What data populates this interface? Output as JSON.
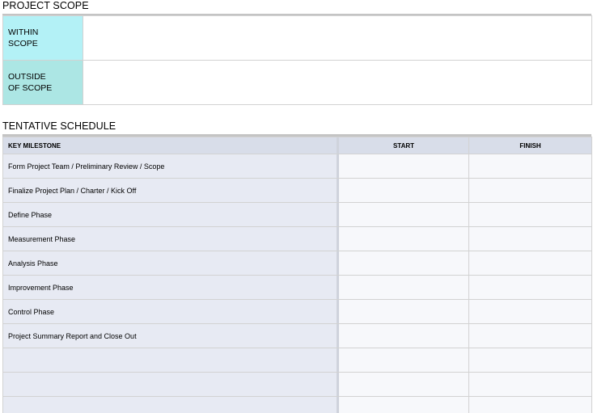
{
  "project_scope": {
    "title": "PROJECT SCOPE",
    "rows": [
      {
        "label": "WITHIN\nSCOPE",
        "value": ""
      },
      {
        "label": "OUTSIDE\nOF SCOPE",
        "value": ""
      }
    ],
    "colors": {
      "within": "#b3f1f6",
      "outside": "#ace6e4"
    }
  },
  "schedule": {
    "title": "TENTATIVE SCHEDULE",
    "headers": {
      "milestone": "KEY MILESTONE",
      "start": "START",
      "finish": "FINISH"
    },
    "rows": [
      {
        "milestone": "Form Project Team / Preliminary Review / Scope",
        "start": "",
        "finish": ""
      },
      {
        "milestone": "Finalize Project Plan / Charter / Kick Off",
        "start": "",
        "finish": ""
      },
      {
        "milestone": "Define Phase",
        "start": "",
        "finish": ""
      },
      {
        "milestone": "Measurement Phase",
        "start": "",
        "finish": ""
      },
      {
        "milestone": "Analysis Phase",
        "start": "",
        "finish": ""
      },
      {
        "milestone": "Improvement Phase",
        "start": "",
        "finish": ""
      },
      {
        "milestone": "Control Phase",
        "start": "",
        "finish": ""
      },
      {
        "milestone": "Project Summary Report and Close Out",
        "start": "",
        "finish": ""
      },
      {
        "milestone": "",
        "start": "",
        "finish": ""
      },
      {
        "milestone": "",
        "start": "",
        "finish": ""
      },
      {
        "milestone": "",
        "start": "",
        "finish": ""
      }
    ]
  }
}
